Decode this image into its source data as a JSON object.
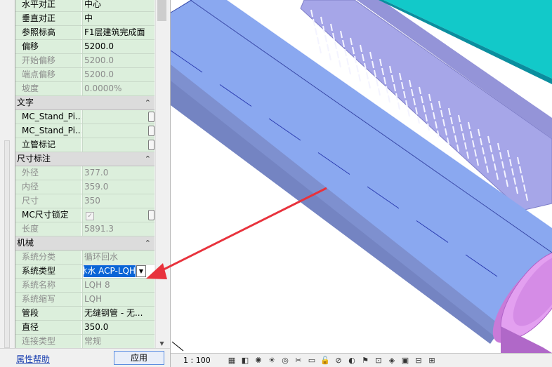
{
  "properties": {
    "rows": [
      {
        "type": "row",
        "label": "水平对正",
        "value": "中心",
        "readonly": false,
        "control": "none"
      },
      {
        "type": "row",
        "label": "垂直对正",
        "value": "中",
        "readonly": false,
        "control": "none"
      },
      {
        "type": "row",
        "label": "参照标高",
        "value": "F1层建筑完成面",
        "readonly": false,
        "control": "none"
      },
      {
        "type": "row",
        "label": "偏移",
        "value": "5200.0",
        "readonly": false,
        "control": "none"
      },
      {
        "type": "row",
        "label": "开始偏移",
        "value": "5200.0",
        "readonly": true,
        "control": "none"
      },
      {
        "type": "row",
        "label": "端点偏移",
        "value": "5200.0",
        "readonly": true,
        "control": "none"
      },
      {
        "type": "row",
        "label": "坡度",
        "value": "0.0000%",
        "readonly": true,
        "control": "none"
      },
      {
        "type": "group",
        "label": "文字",
        "chevron": "«"
      },
      {
        "type": "row",
        "label": "MC_Stand_Pi...",
        "value": "",
        "readonly": false,
        "control": "button"
      },
      {
        "type": "row",
        "label": "MC_Stand_Pi...",
        "value": "",
        "readonly": false,
        "control": "button"
      },
      {
        "type": "row",
        "label": "立管标记",
        "value": "",
        "readonly": false,
        "control": "button"
      },
      {
        "type": "group",
        "label": "尺寸标注",
        "chevron": "«"
      },
      {
        "type": "row",
        "label": "外径",
        "value": "377.0",
        "readonly": true,
        "control": "none"
      },
      {
        "type": "row",
        "label": "内径",
        "value": "359.0",
        "readonly": true,
        "control": "none"
      },
      {
        "type": "row",
        "label": "尺寸",
        "value": "350",
        "readonly": true,
        "control": "none"
      },
      {
        "type": "row",
        "label": "MC尺寸锁定",
        "value": "",
        "readonly": false,
        "control": "checkbox-button",
        "checked": true
      },
      {
        "type": "row",
        "label": "长度",
        "value": "5891.3",
        "readonly": true,
        "control": "none"
      },
      {
        "type": "group",
        "label": "机械",
        "chevron": "«"
      },
      {
        "type": "row",
        "label": "系统分类",
        "value": "循环回水",
        "readonly": true,
        "control": "none"
      },
      {
        "type": "row",
        "label": "系统类型",
        "value": "冰水 ACP-LQH",
        "readonly": false,
        "control": "dropdown",
        "selected": true
      },
      {
        "type": "row",
        "label": "系统名称",
        "value": "LQH 8",
        "readonly": true,
        "control": "none"
      },
      {
        "type": "row",
        "label": "系统缩写",
        "value": "LQH",
        "readonly": true,
        "control": "none"
      },
      {
        "type": "row",
        "label": "管段",
        "value": "无缝钢管 - 无...",
        "readonly": false,
        "control": "none"
      },
      {
        "type": "row",
        "label": "直径",
        "value": "350.0",
        "readonly": false,
        "control": "none"
      },
      {
        "type": "row",
        "label": "连接类型",
        "value": "常规",
        "readonly": true,
        "control": "none"
      }
    ],
    "footer": {
      "help_link": "属性帮助",
      "apply_button": "应用"
    }
  },
  "view": {
    "scale_label": "1 : 100",
    "toolbar_icons": [
      "detail-level-icon",
      "visual-style-icon",
      "sun-path-icon",
      "shadows-icon",
      "render-icon",
      "crop-view-icon",
      "show-crop-icon",
      "unlock-view-icon",
      "temporary-hide-icon",
      "reveal-hidden-icon",
      "worksharing-icon",
      "analytical-model-icon",
      "highlight-displacement-icon",
      "temporary-view-properties-icon",
      "hide-constraints-icon",
      "show-constraints-icon"
    ],
    "colors": {
      "pipe": "#8aa8f0",
      "pipe_shadow": "#7d8fcf",
      "cable_tray": "#a6a6e8",
      "duct": "#0fc2c2",
      "flange": "#d98ae8",
      "annotation_arrow": "#e8323c"
    }
  }
}
